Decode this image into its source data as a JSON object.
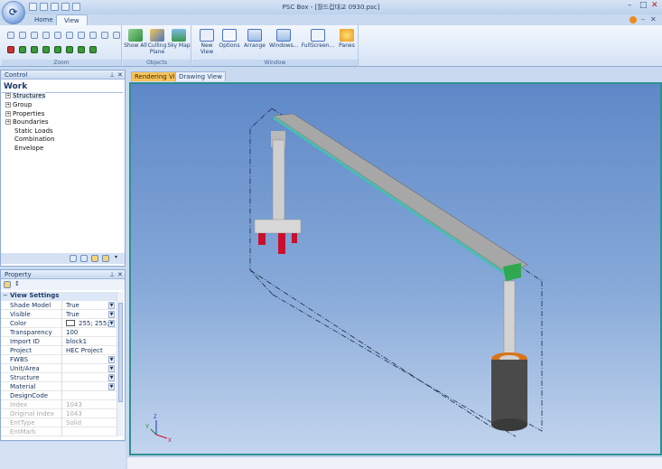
{
  "window": {
    "title": "PSC Box - [월드컵대교 0930.psc]"
  },
  "ribbon": {
    "tabs": [
      {
        "label": "Home"
      },
      {
        "label": "View"
      }
    ],
    "groups": {
      "zoom": {
        "label": "Zoom"
      },
      "objects": {
        "label": "Objects",
        "show_all": "Show All",
        "culling_plane": "Culling Plane",
        "sky_map": "Sky Map"
      },
      "window": {
        "label": "Window",
        "new_view": "New View",
        "options": "Options",
        "arrange": "Arrange",
        "windows": "Windows...",
        "fullscreen": "FullScreen...",
        "panes": "Panes"
      }
    }
  },
  "control": {
    "title": "Control",
    "root": "Work",
    "items": [
      {
        "label": "Structures",
        "expander": "+"
      },
      {
        "label": "Group",
        "expander": "+"
      },
      {
        "label": "Properties",
        "expander": "+"
      },
      {
        "label": "Boundaries",
        "expander": "+"
      },
      {
        "label": "Static Loads",
        "expander": ""
      },
      {
        "label": "Combination",
        "expander": ""
      },
      {
        "label": "Envelope",
        "expander": ""
      }
    ]
  },
  "property": {
    "title": "Property",
    "category": "View Settings",
    "rows": [
      {
        "key": "Shade Model",
        "value": "True"
      },
      {
        "key": "Visible",
        "value": "True"
      },
      {
        "key": "Color",
        "value": "255; 255;"
      },
      {
        "key": "Transparency",
        "value": "100"
      },
      {
        "key": "Import ID",
        "value": "block1"
      },
      {
        "key": "Project",
        "value": "HEC Project"
      },
      {
        "key": "FWBS",
        "value": ""
      },
      {
        "key": "Unit/Area",
        "value": ""
      },
      {
        "key": "Structure",
        "value": ""
      },
      {
        "key": "Material",
        "value": ""
      },
      {
        "key": "DesignCode",
        "value": ""
      },
      {
        "key": "Index",
        "value": "1043"
      },
      {
        "key": "Original Index",
        "value": "1043"
      },
      {
        "key": "EntType",
        "value": "Solid"
      },
      {
        "key": "EntMark",
        "value": ""
      }
    ]
  },
  "viewtabs": [
    {
      "label": "Rendering View"
    },
    {
      "label": "Drawing View"
    }
  ],
  "axes": {
    "x": "X",
    "y": "Y",
    "z": "Z"
  },
  "colors": {
    "accent": "#f7c35a",
    "viewport_border": "#2e8f8f",
    "pier_red": "#c8102e",
    "bearing_green": "#2fa84f",
    "footing_orange": "#d9731a"
  }
}
